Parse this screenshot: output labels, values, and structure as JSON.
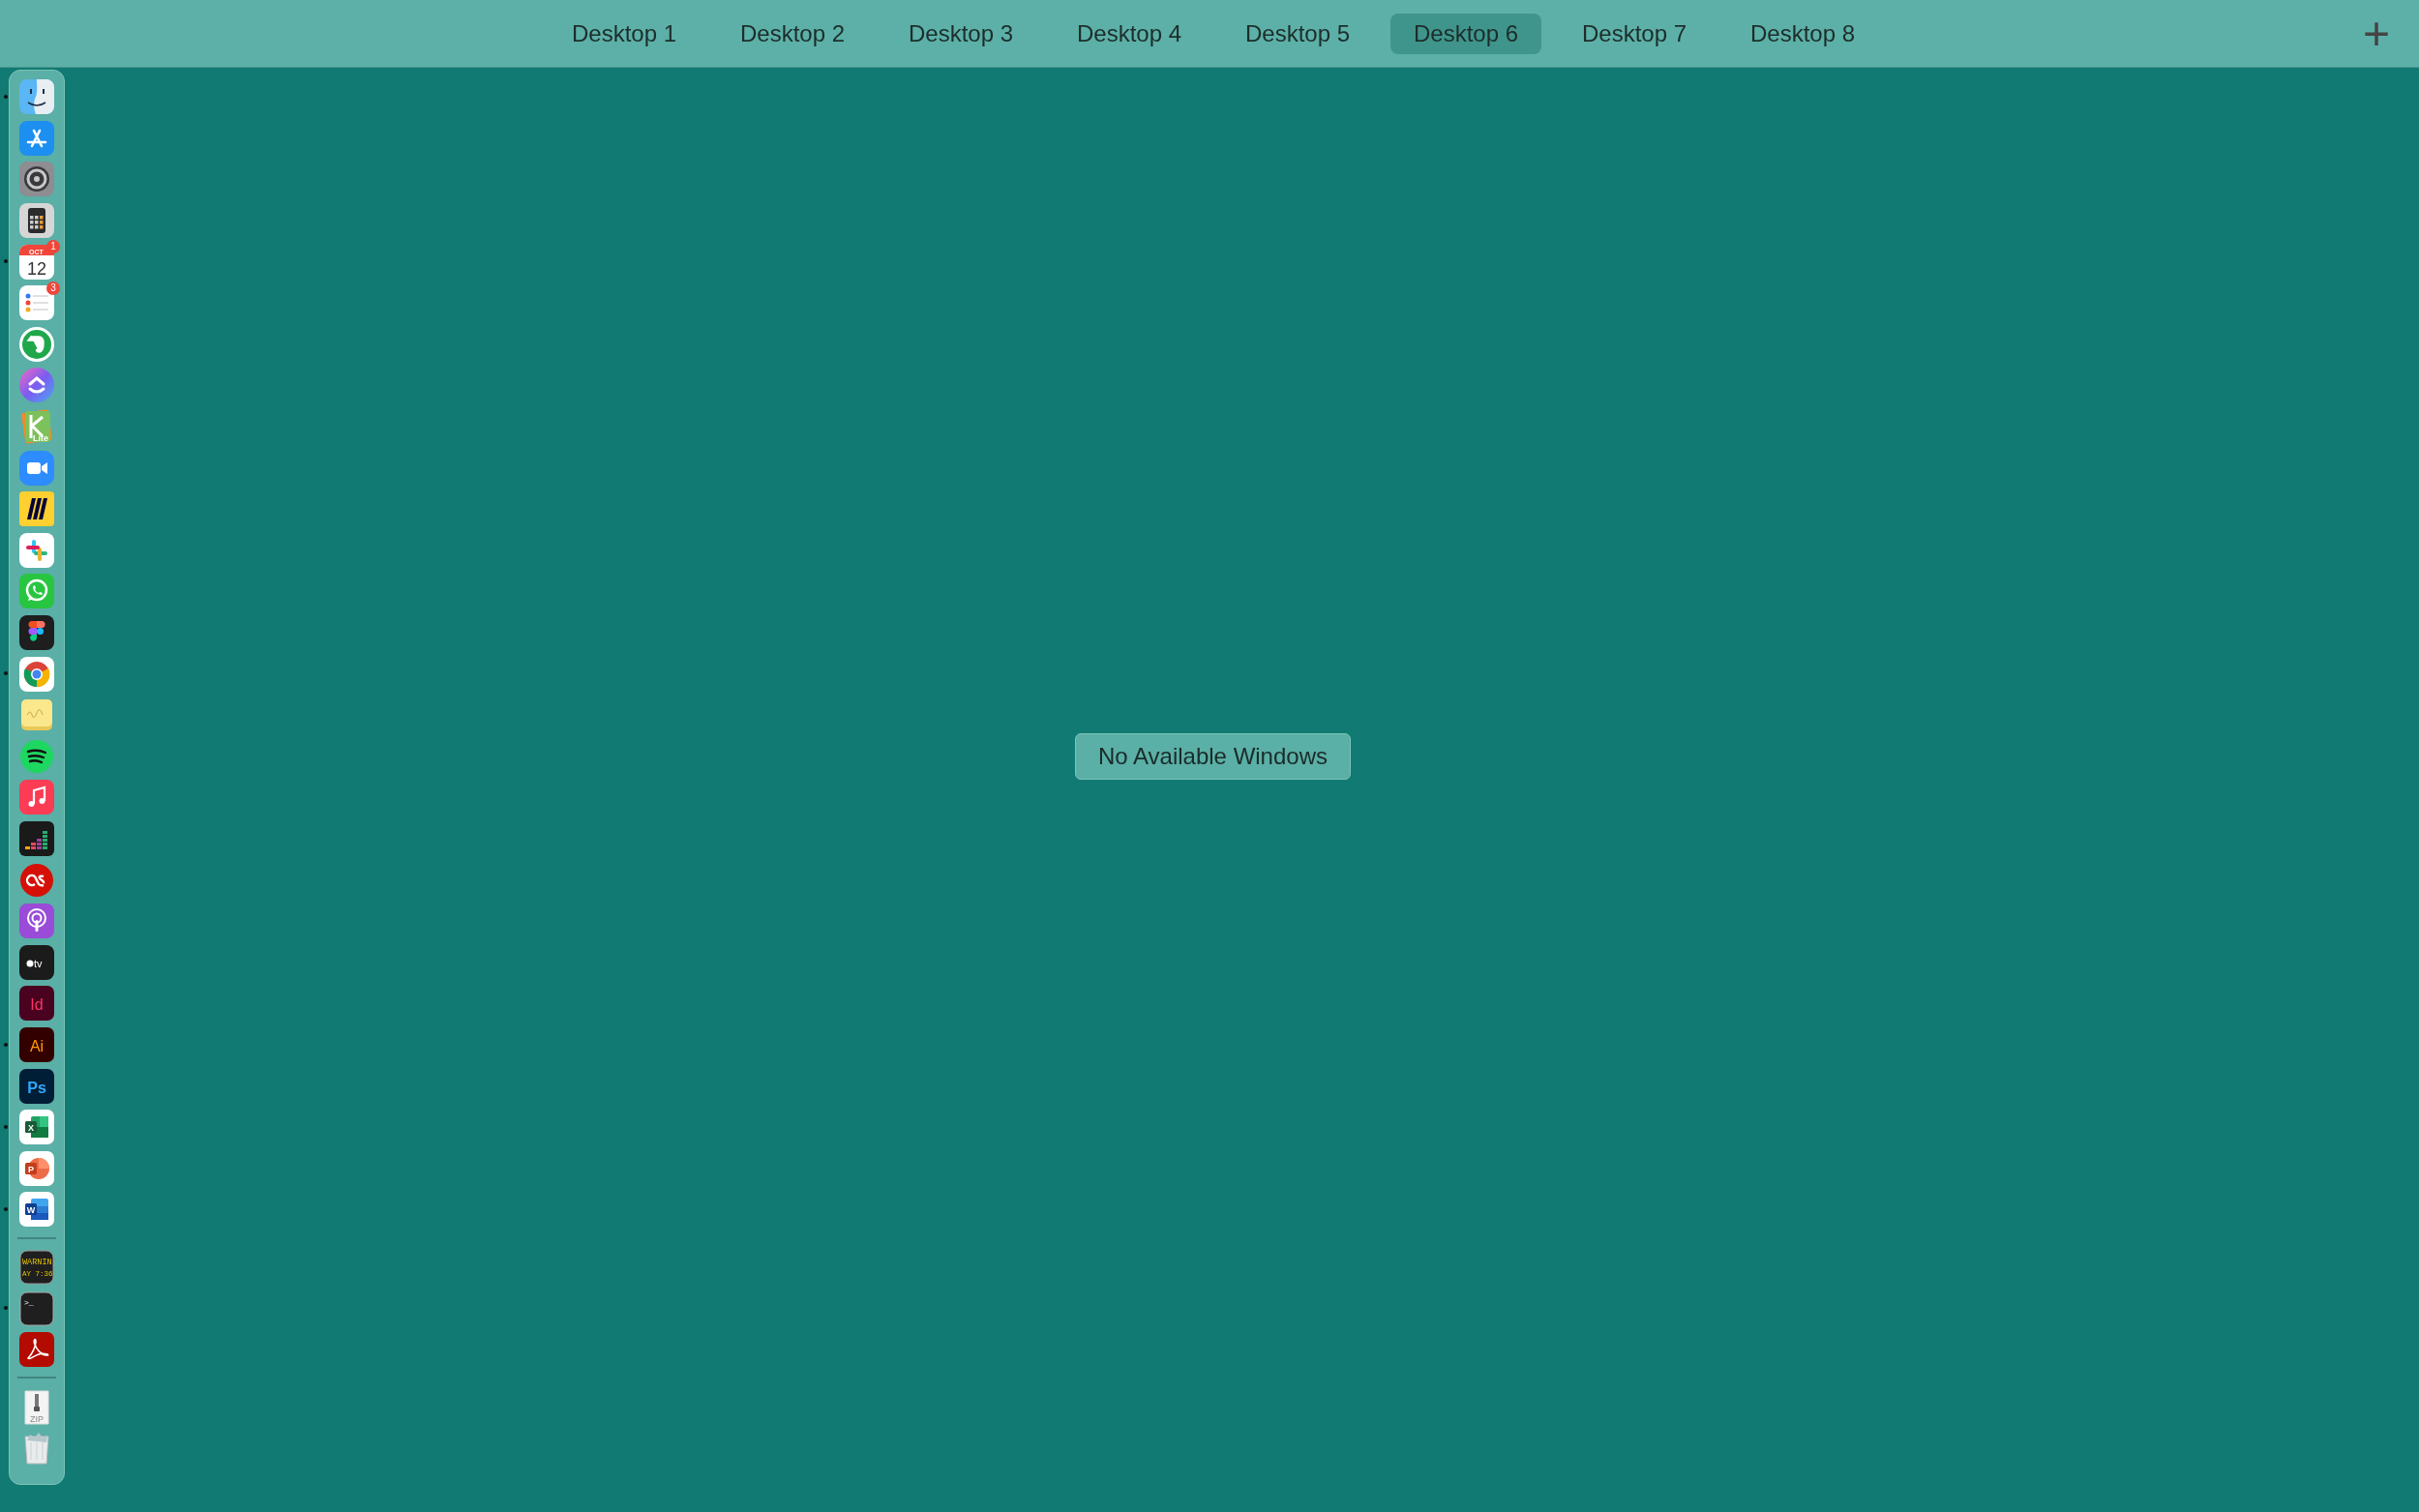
{
  "spaces_bar": {
    "desktops": [
      {
        "label": "Desktop 1",
        "selected": false
      },
      {
        "label": "Desktop 2",
        "selected": false
      },
      {
        "label": "Desktop 3",
        "selected": false
      },
      {
        "label": "Desktop 4",
        "selected": false
      },
      {
        "label": "Desktop 5",
        "selected": false
      },
      {
        "label": "Desktop 6",
        "selected": true
      },
      {
        "label": "Desktop 7",
        "selected": false
      },
      {
        "label": "Desktop 8",
        "selected": false
      }
    ],
    "add_button": "+"
  },
  "dock": {
    "sections": [
      [
        {
          "kind": "finder",
          "running": true
        },
        {
          "kind": "appstore",
          "running": false
        },
        {
          "kind": "settings",
          "running": false
        },
        {
          "kind": "calculator",
          "running": false
        },
        {
          "kind": "calendar",
          "running": true,
          "badge": "1",
          "glyph": "OCT",
          "glyph_2": "12"
        },
        {
          "kind": "reminders",
          "running": false,
          "badge": "3"
        },
        {
          "kind": "evernote",
          "running": false
        },
        {
          "kind": "clickup",
          "running": false
        },
        {
          "kind": "kite",
          "running": false,
          "glyph": "Lite"
        },
        {
          "kind": "zoom",
          "running": false
        },
        {
          "kind": "miro",
          "running": false
        },
        {
          "kind": "slack",
          "running": false
        },
        {
          "kind": "whatsapp",
          "running": false
        },
        {
          "kind": "figma",
          "running": false
        },
        {
          "kind": "chrome",
          "running": true
        },
        {
          "kind": "stickies",
          "running": false
        },
        {
          "kind": "spotify",
          "running": false
        },
        {
          "kind": "music",
          "running": false
        },
        {
          "kind": "deezer",
          "running": false
        },
        {
          "kind": "lastfm",
          "running": false
        },
        {
          "kind": "podcasts",
          "running": false
        },
        {
          "kind": "tv",
          "running": false,
          "glyph": "tv"
        },
        {
          "kind": "indesign",
          "running": false,
          "glyph": "Id"
        },
        {
          "kind": "illustrator",
          "running": true,
          "glyph": "Ai"
        },
        {
          "kind": "photoshop",
          "running": false,
          "glyph": "Ps"
        },
        {
          "kind": "excel",
          "running": true,
          "glyph": "X"
        },
        {
          "kind": "powerpoint",
          "running": false,
          "glyph": "P"
        },
        {
          "kind": "word",
          "running": true,
          "glyph": "W"
        }
      ],
      [
        {
          "kind": "console",
          "running": false,
          "glyph": "WARNIN",
          "glyph_2": "AY 7:36"
        },
        {
          "kind": "terminal",
          "running": true,
          "glyph": ">_"
        },
        {
          "kind": "acrobat",
          "running": false
        }
      ],
      [
        {
          "kind": "zip",
          "running": false,
          "glyph": "ZIP"
        },
        {
          "kind": "trash",
          "running": false
        }
      ]
    ]
  },
  "message": "No Available Windows"
}
